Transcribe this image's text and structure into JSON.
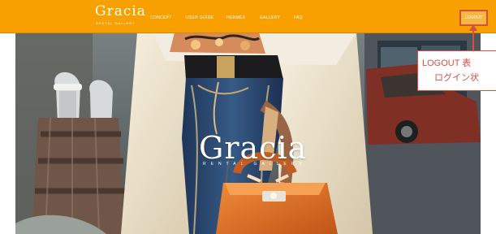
{
  "brand": {
    "logo": "Gracia",
    "subtitle": "RENTAL GALLERY"
  },
  "nav": {
    "items": [
      "CONCEPT",
      "USER GUIDE",
      "HERMES",
      "GALLERY",
      "FAQ"
    ]
  },
  "header": {
    "logout_label": "LOGOUT"
  },
  "hero": {
    "logo": "Gracia",
    "subtitle": "RENTAL GALLERY"
  },
  "annotation": {
    "line1": "LOGOUT 表",
    "line2": "ログイン状"
  },
  "colors": {
    "nav_orange": "#f7a000",
    "annotation_red": "#d65040"
  }
}
